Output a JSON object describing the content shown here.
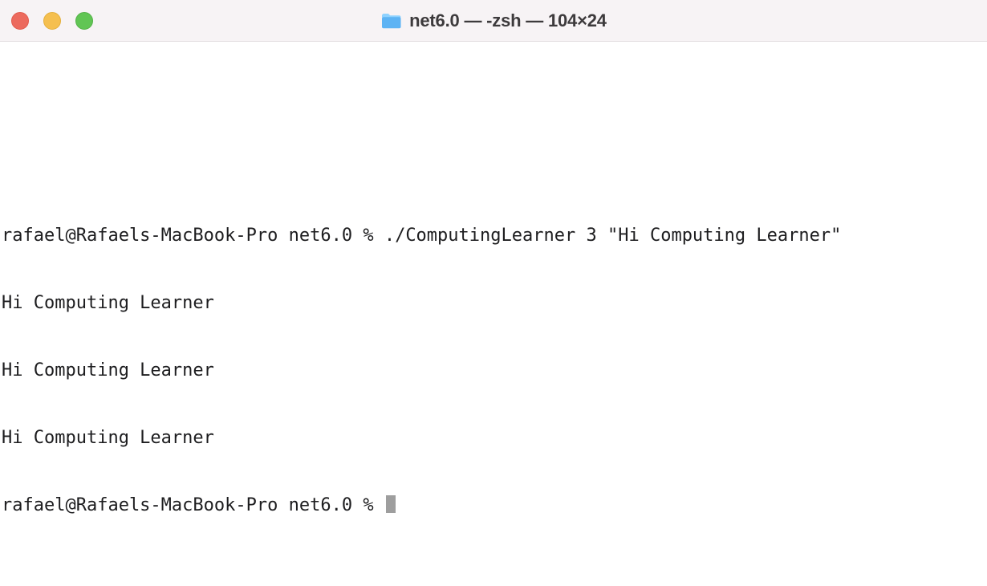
{
  "titlebar": {
    "title": "net6.0 — -zsh — 104×24",
    "folder_icon": "folder-icon",
    "title_icon_color_top": "#8fd2ff",
    "title_icon_color_body": "#5db3f4"
  },
  "terminal": {
    "lines": [
      "rafael@Rafaels-MacBook-Pro net6.0 % ./ComputingLearner 3 \"Hi Computing Learner\"",
      "Hi Computing Learner",
      "Hi Computing Learner",
      "Hi Computing Learner"
    ],
    "prompt": "rafael@Rafaels-MacBook-Pro net6.0 % "
  }
}
